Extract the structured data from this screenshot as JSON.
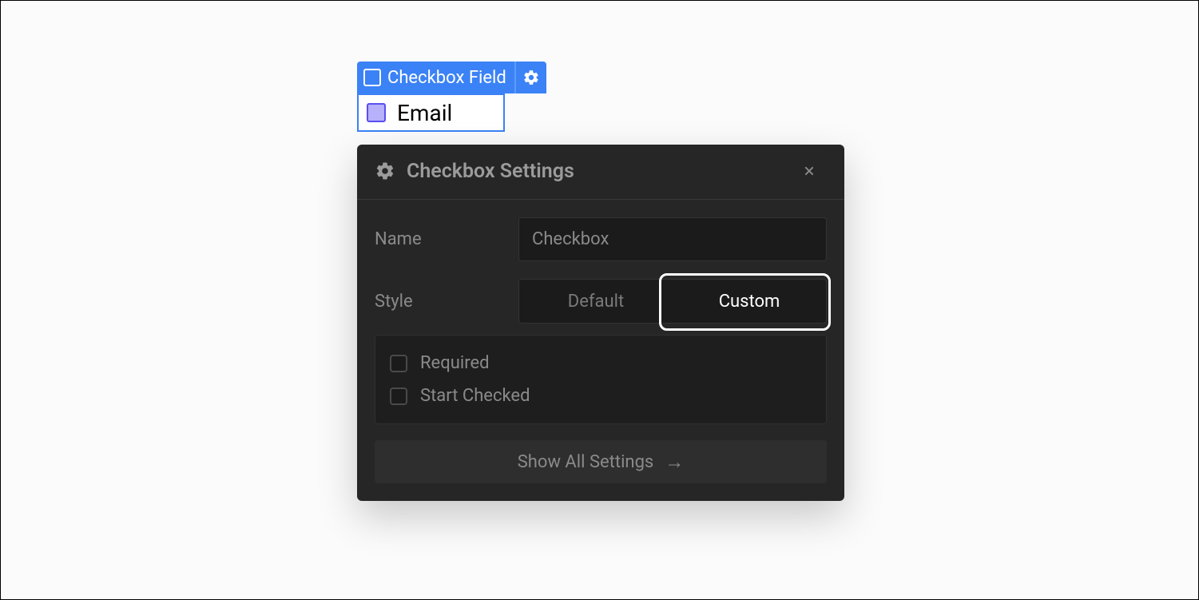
{
  "tag": {
    "label": "Checkbox Field"
  },
  "field": {
    "label": "Email"
  },
  "panel": {
    "title": "Checkbox Settings",
    "name_label": "Name",
    "name_value": "Checkbox",
    "style_label": "Style",
    "style_options": {
      "default": "Default",
      "custom": "Custom"
    },
    "options": {
      "required": "Required",
      "start_checked": "Start Checked"
    },
    "footer": "Show All Settings"
  }
}
